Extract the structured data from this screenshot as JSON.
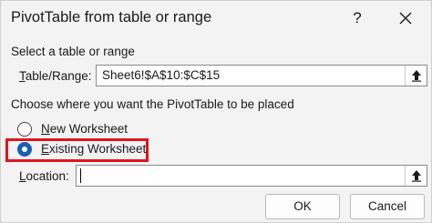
{
  "dialog": {
    "title": "PivotTable from table or range",
    "help_label": "?",
    "close_icon": "close-icon"
  },
  "source": {
    "heading": "Select a table or range",
    "label_pre": "",
    "label_u": "T",
    "label_post": "able/Range:",
    "value": "Sheet6!$A$10:$C$15",
    "collapse_icon": "collapse-dialog-icon"
  },
  "placement": {
    "heading": "Choose where you want the PivotTable to be placed",
    "options": [
      {
        "label_u": "N",
        "label_post": "ew Worksheet",
        "checked": false
      },
      {
        "label_u": "E",
        "label_post": "xisting Worksheet",
        "checked": true
      }
    ],
    "location_label_u": "L",
    "location_label_post": "ocation:",
    "location_value": "",
    "collapse_icon": "collapse-dialog-icon"
  },
  "buttons": {
    "ok": "OK",
    "cancel": "Cancel"
  },
  "colors": {
    "highlight": "#e0141e",
    "radio_accent": "#1a5fb4"
  }
}
